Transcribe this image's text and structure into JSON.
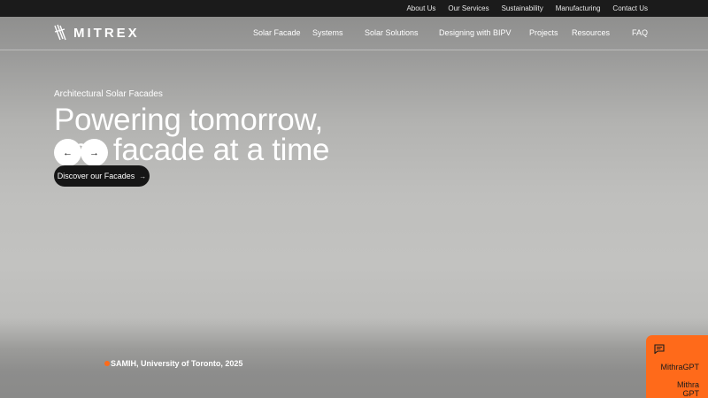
{
  "colors": {
    "accent": "#ff6a1a",
    "topbar_bg": "#1b1b1b",
    "cta_bg": "#161616"
  },
  "topbar": {
    "links": [
      "About Us",
      "Our Services",
      "Sustainability",
      "Manufacturing",
      "Contact Us"
    ]
  },
  "nav": {
    "logo_text": "MITREX",
    "items": [
      "Solar Facade",
      "Systems",
      "Solar Solutions",
      "Designing with BIPV",
      "Projects",
      "Resources",
      "FAQ"
    ]
  },
  "hero": {
    "eyebrow": "Architectural Solar Facades",
    "headline_line1": "Powering tomorrow,",
    "headline_line2": "one facade at a time",
    "cta_label": "Discover our Facades",
    "cta_icon": "arrow-right-icon",
    "prev_icon": "arrow-left-icon",
    "prev_glyph": "←",
    "next_icon": "arrow-right-icon",
    "next_glyph": "→",
    "caption": "SAMIH, University of Toronto, 2025"
  },
  "chat": {
    "icon": "chat-bubble-icon",
    "title": "MithraGPT",
    "subtitle": "Mithra GPT"
  }
}
